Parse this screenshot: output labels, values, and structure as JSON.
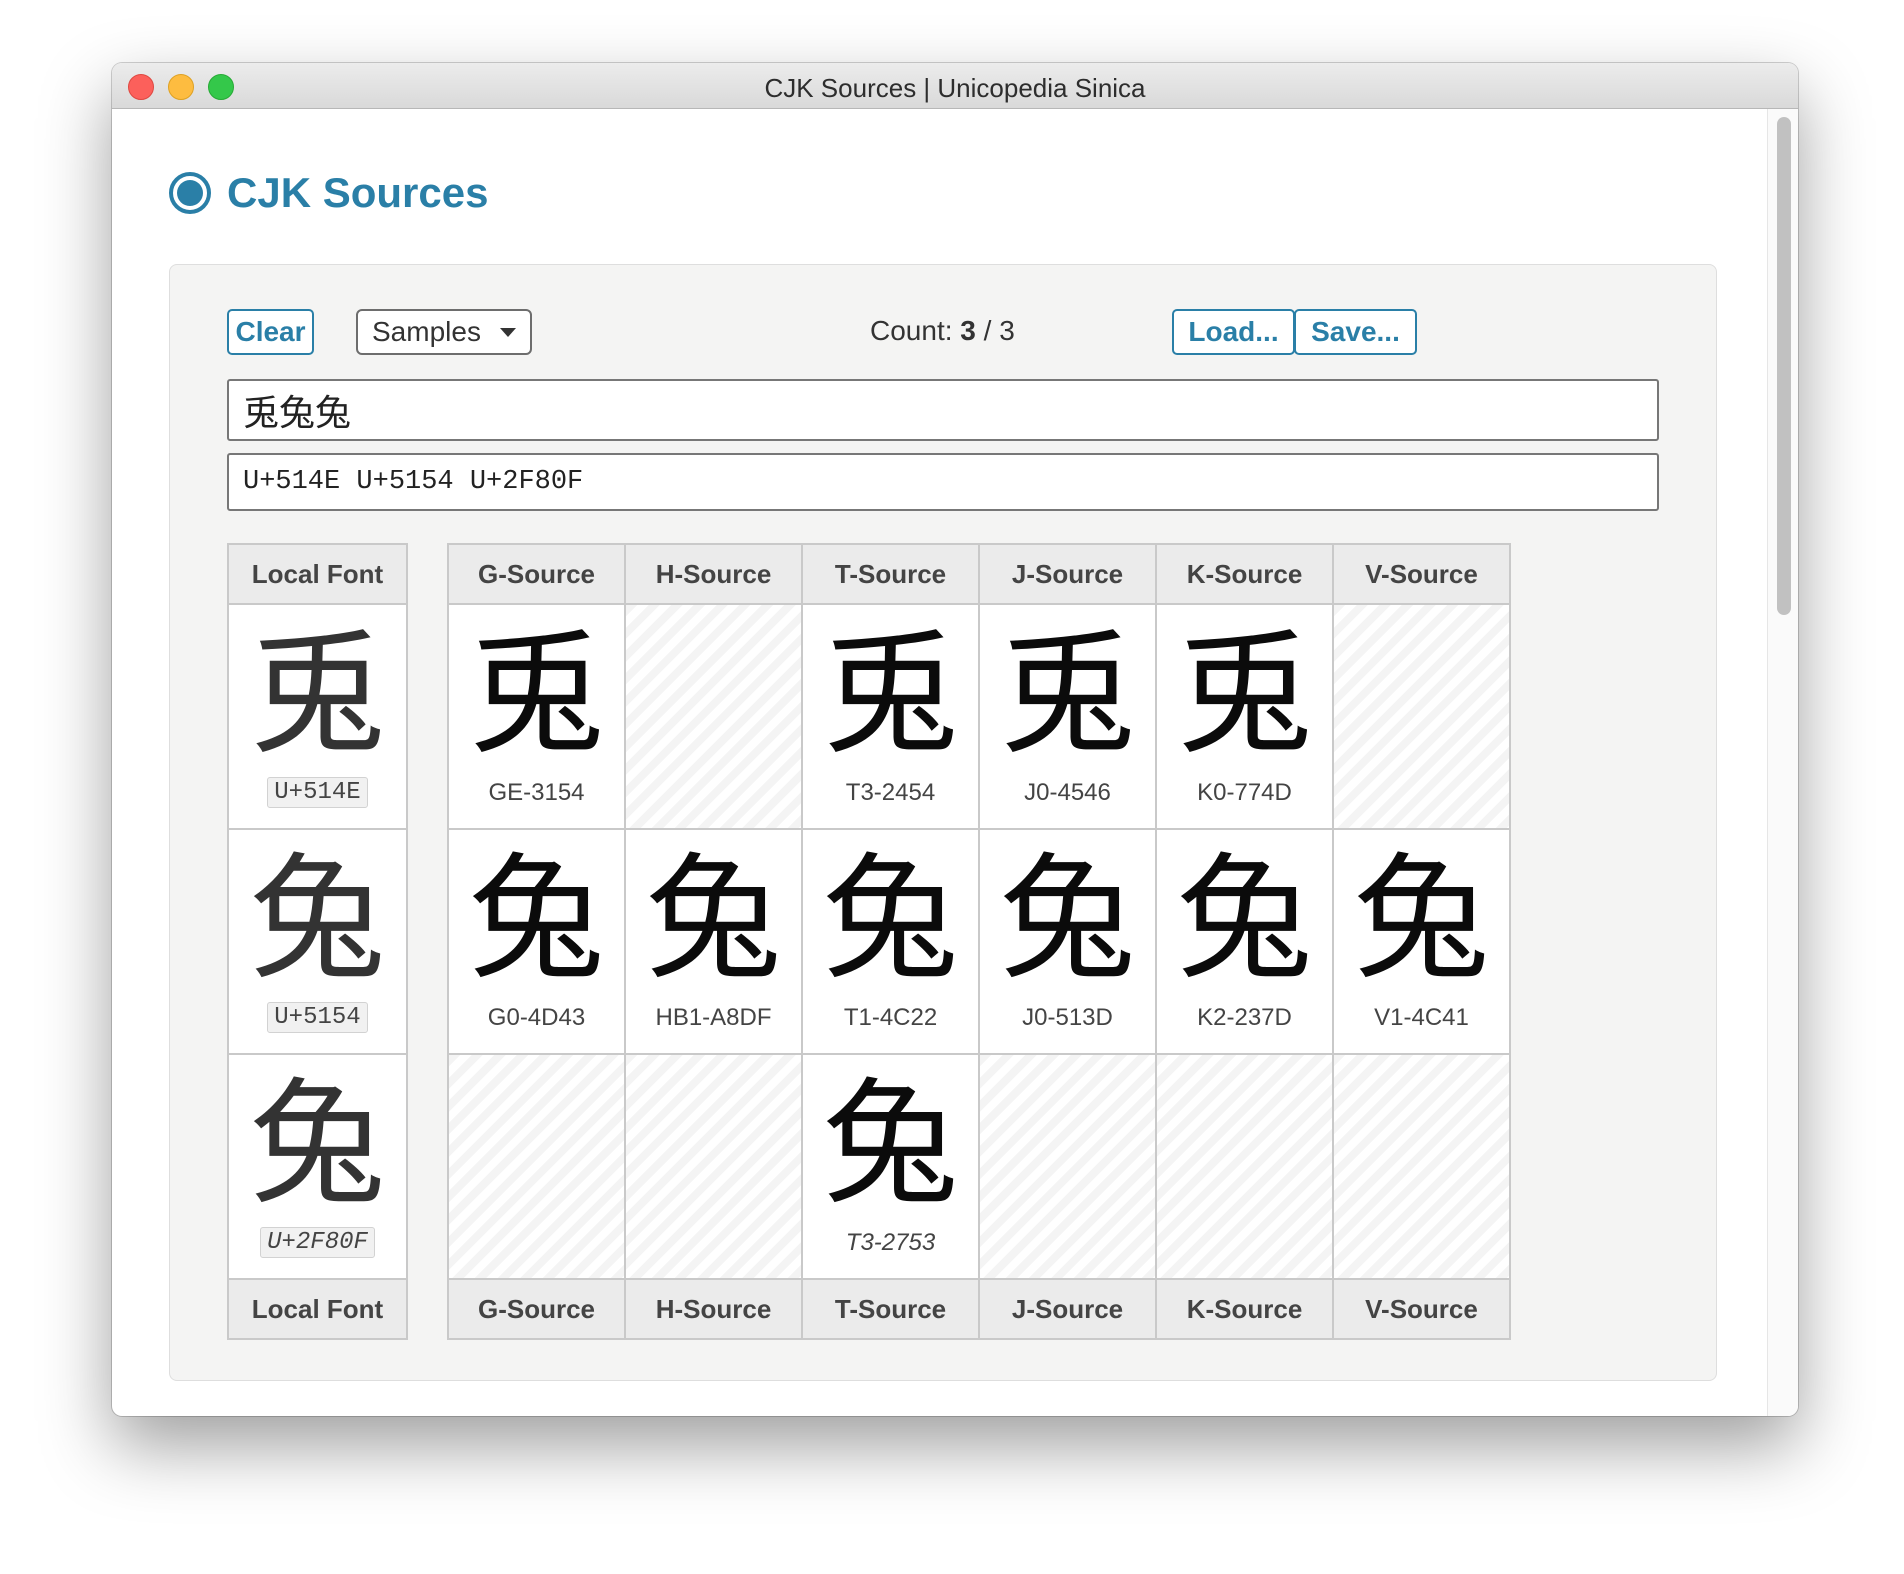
{
  "window": {
    "title": "CJK Sources | Unicopedia Sinica"
  },
  "page": {
    "title": "CJK Sources"
  },
  "toolbar": {
    "clear_label": "Clear",
    "samples_label": "Samples",
    "count_prefix": "Count:",
    "count_current": "3",
    "count_sep": "/",
    "count_total": "3",
    "load_label": "Load...",
    "save_label": "Save..."
  },
  "inputs": {
    "characters_value": "兎兔兔",
    "codepoints_value": "U+514E U+5154 U+2F80F"
  },
  "table": {
    "local_header": "Local Font",
    "source_headers": [
      "G-Source",
      "H-Source",
      "T-Source",
      "J-Source",
      "K-Source",
      "V-Source"
    ],
    "rows": [
      {
        "char": "兎",
        "code": "U+514E",
        "compat": false,
        "sources": [
          {
            "glyph": "兎",
            "label": "GE-3154"
          },
          null,
          {
            "glyph": "兎",
            "label": "T3-2454"
          },
          {
            "glyph": "兎",
            "label": "J0-4546"
          },
          {
            "glyph": "兎",
            "label": "K0-774D"
          },
          null
        ]
      },
      {
        "char": "兔",
        "code": "U+5154",
        "compat": false,
        "sources": [
          {
            "glyph": "兔",
            "label": "G0-4D43"
          },
          {
            "glyph": "兔",
            "label": "HB1-A8DF"
          },
          {
            "glyph": "兔",
            "label": "T1-4C22"
          },
          {
            "glyph": "兔",
            "label": "J0-513D"
          },
          {
            "glyph": "兔",
            "label": "K2-237D"
          },
          {
            "glyph": "兔",
            "label": "V1-4C41"
          }
        ]
      },
      {
        "char": "兔",
        "code": "U+2F80F",
        "compat": true,
        "sources": [
          null,
          null,
          {
            "glyph": "兔",
            "label": "T3-2753"
          },
          null,
          null,
          null
        ]
      }
    ]
  }
}
